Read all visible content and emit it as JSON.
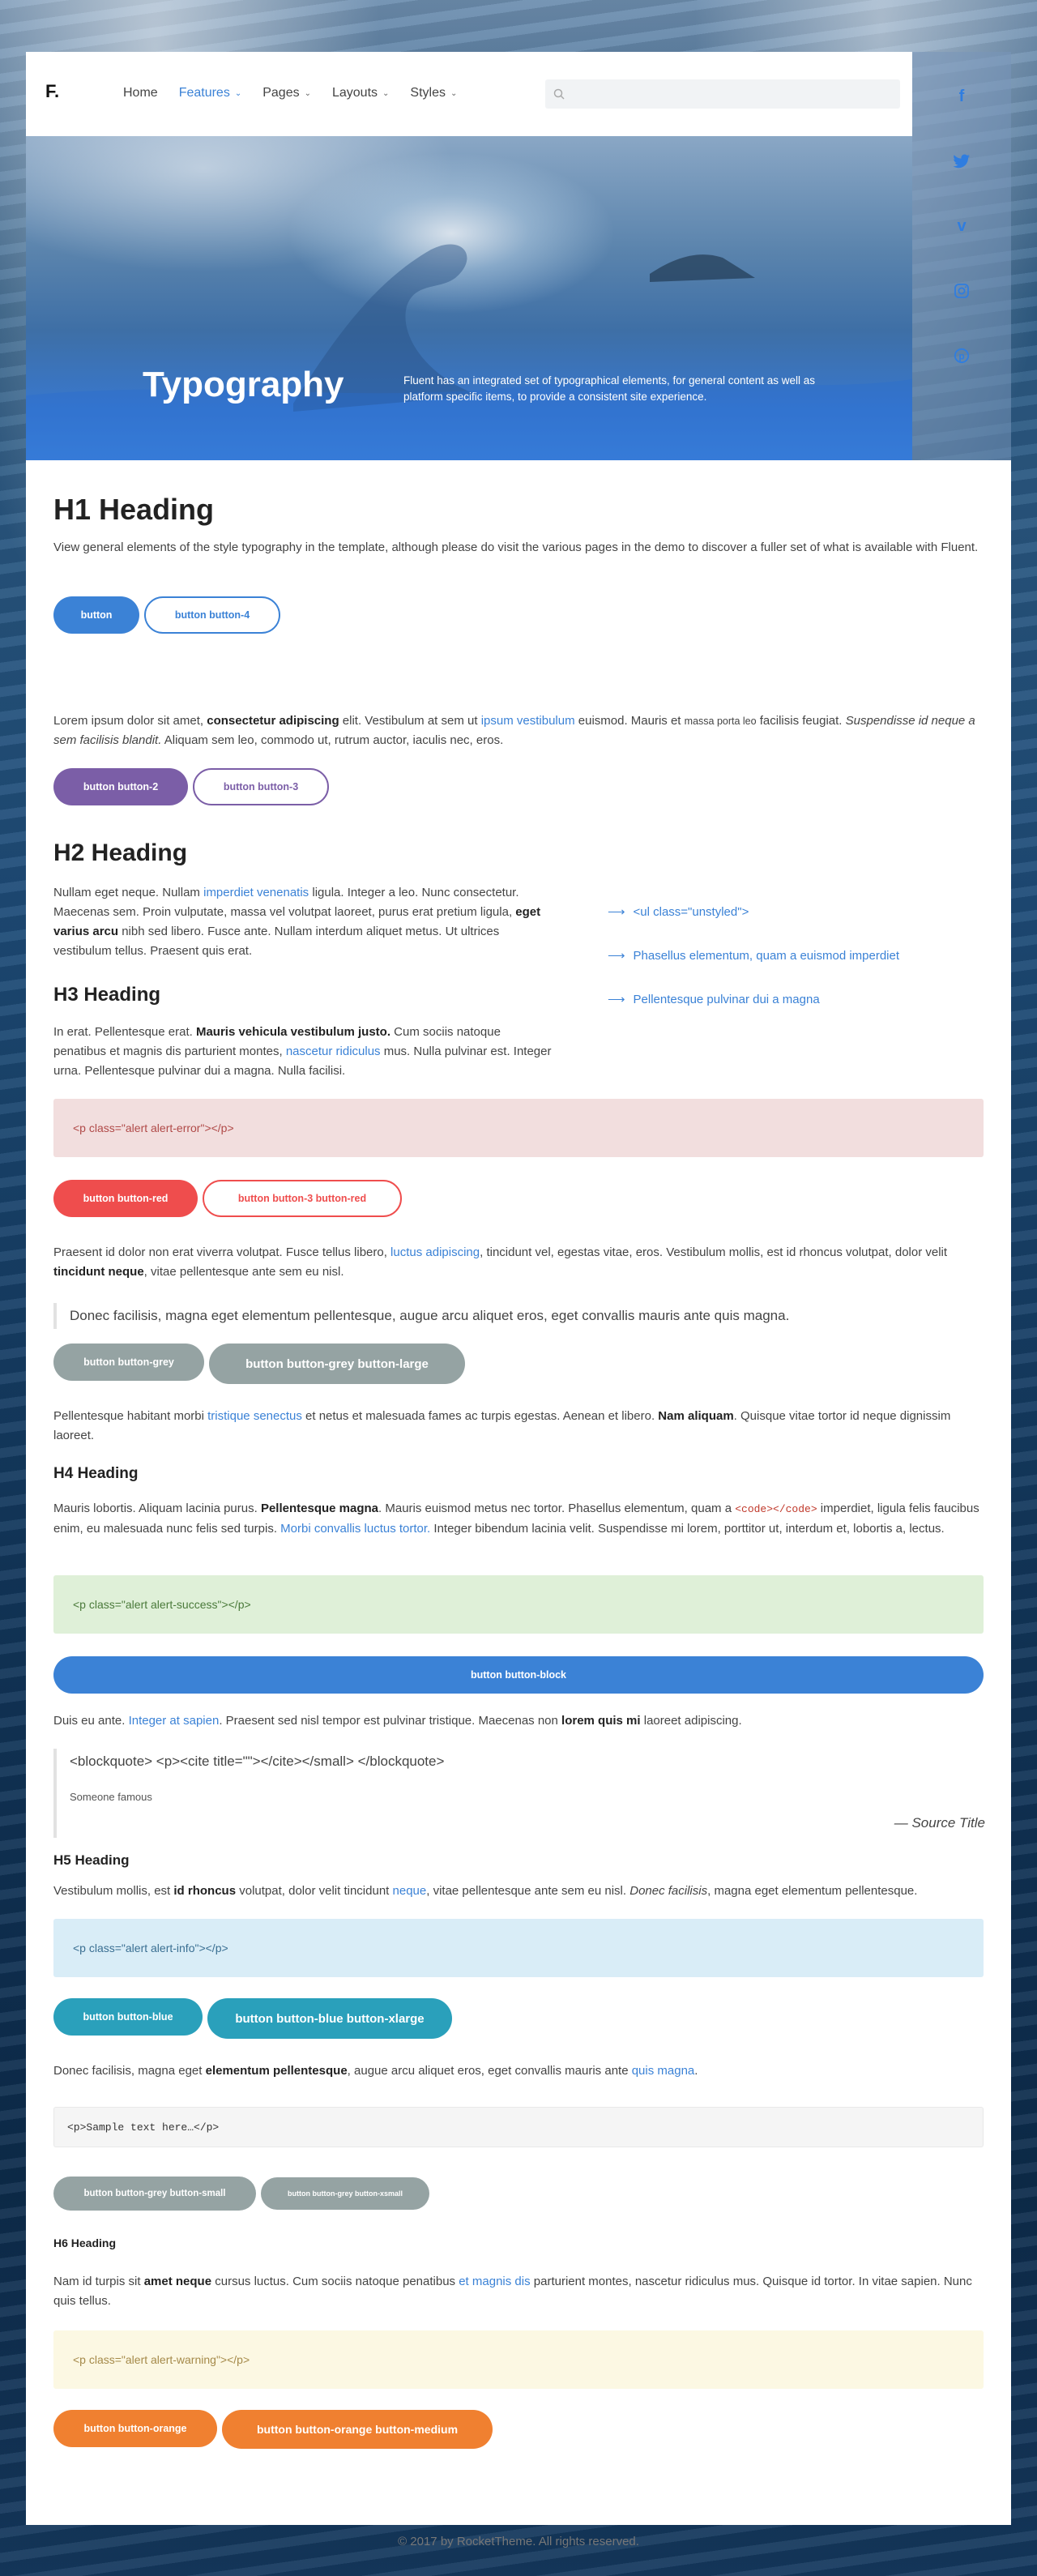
{
  "header": {
    "logo": "F.",
    "nav": [
      {
        "label": "Home",
        "active": false,
        "has_dropdown": false
      },
      {
        "label": "Features",
        "active": true,
        "has_dropdown": true
      },
      {
        "label": "Pages",
        "active": false,
        "has_dropdown": true
      },
      {
        "label": "Layouts",
        "active": false,
        "has_dropdown": true
      },
      {
        "label": "Styles",
        "active": false,
        "has_dropdown": true
      }
    ],
    "search_placeholder": ""
  },
  "social": [
    "facebook-icon",
    "twitter-icon",
    "vimeo-icon",
    "instagram-icon",
    "pinterest-icon"
  ],
  "hero": {
    "title": "Typography",
    "description": "Fluent has an integrated set of typographical elements, for general content as well as platform specific items, to provide a consistent site experience."
  },
  "content": {
    "h1": "H1 Heading",
    "intro": "View general elements of the style typography in the template, although please do visit the various pages in the demo to discover a fuller set of what is available with Fluent.",
    "btn_button": "button",
    "btn_button4": "button button-4",
    "para1": {
      "a": "Lorem ipsum dolor sit amet, ",
      "b": "consectetur adipiscing",
      "c": " elit. Vestibulum at sem ut ",
      "link": "ipsum vestibulum",
      "d": " euismod. Mauris et ",
      "small": "massa porta leo",
      "e": " facilisis feugiat. ",
      "em": "Suspendisse id neque a sem facilisis blandit.",
      "f": " Aliquam sem leo, commodo ut, rutrum auctor, iaculis nec, eros."
    },
    "btn_button2": "button button-2",
    "btn_button3": "button button-3",
    "h2": "H2 Heading",
    "para2": {
      "a": "Nullam eget neque. Nullam ",
      "link": "imperdiet venenatis",
      "b": " ligula. Integer a leo. Nunc consectetur. Maecenas sem. Proin vulputate, massa vel volutpat laoreet, purus erat pretium ligula, ",
      "bold": "eget varius arcu",
      "c": " nibh sed libero. Fusce ante. Nullam interdum aliquet metus. Ut ultrices vestibulum tellus. Praesent quis erat."
    },
    "list": [
      "<ul class=\"unstyled\">",
      "Phasellus elementum, quam a euismod imperdiet",
      "Pellentesque pulvinar dui a magna"
    ],
    "h3": "H3 Heading",
    "para3": {
      "a": "In erat. Pellentesque erat. ",
      "bold": "Mauris vehicula vestibulum justo.",
      "b": " Cum sociis natoque penatibus et magnis dis parturient montes, ",
      "link": "nascetur ridiculus",
      "c": " mus. Nulla pulvinar est. Integer urna. Pellentesque pulvinar dui a magna. Nulla facilisi."
    },
    "alert_error": "<p class=\"alert alert-error\"></p>",
    "btn_red": "button button-red",
    "btn_red3": "button button-3 button-red",
    "para4": {
      "a": "Praesent id dolor non erat viverra volutpat. Fusce tellus libero, ",
      "link": "luctus adipiscing",
      "b": ", tincidunt vel, egestas vitae, eros. Vestibulum mollis, est id rhoncus volutpat, dolor velit ",
      "bold": "tincidunt neque",
      "c": ", vitae pellentesque ante sem eu nisl."
    },
    "quote1": "Donec facilisis, magna eget elementum pellentesque, augue arcu aliquet eros, eget convallis mauris ante quis magna.",
    "btn_grey": "button button-grey",
    "btn_grey_large": "button button-grey button-large",
    "para5": {
      "a": "Pellentesque habitant morbi ",
      "link": "tristique senectus",
      "b": " et netus et malesuada fames ac turpis egestas. Aenean et libero. ",
      "bold": "Nam aliquam",
      "c": ". Quisque vitae tortor id neque dignissim laoreet."
    },
    "h4": "H4 Heading",
    "para6": {
      "a": "Mauris lobortis. Aliquam lacinia purus. ",
      "bold": "Pellentesque magna",
      "b": ". Mauris euismod metus nec tortor. Phasellus elementum, quam a ",
      "code": "<code></code>",
      "c": " imperdiet, ligula felis faucibus enim, eu malesuada nunc felis sed turpis. ",
      "link": "Morbi convallis luctus tortor.",
      "d": " Integer bibendum lacinia velit. Suspendisse mi lorem, porttitor ut, interdum et, lobortis a, lectus."
    },
    "alert_success": "<p class=\"alert alert-success\"></p>",
    "btn_block": "button button-block",
    "para7": {
      "a": "Duis eu ante. ",
      "link": "Integer at sapien",
      "b": ". Praesent sed nisl tempor est pulvinar tristique. Maecenas non ",
      "bold": "lorem quis mi",
      "c": " laoreet adipiscing."
    },
    "blockquote": {
      "text": "<blockquote> <p><cite title=\"\"></cite></small> </blockquote>",
      "author": "Someone famous",
      "source": "— Source Title"
    },
    "h5": "H5 Heading",
    "para8": {
      "a": "Vestibulum mollis, est ",
      "bold": "id rhoncus",
      "b": " volutpat, dolor velit tincidunt ",
      "link": "neque",
      "c": ", vitae pellentesque ante sem eu nisl. ",
      "em": "Donec facilisis",
      "d": ", magna eget elementum pellentesque."
    },
    "alert_info": "<p class=\"alert alert-info\"></p>",
    "btn_blue": "button button-blue",
    "btn_blue_xlarge": "button button-blue button-xlarge",
    "para9": {
      "a": "Donec facilisis, magna eget ",
      "bold": "elementum pellentesque",
      "b": ", augue arcu aliquet eros, eget convallis mauris ante ",
      "link": "quis magna",
      "c": "."
    },
    "pre": "<p>Sample text here…</p>",
    "btn_grey_small": "button button-grey button-small",
    "btn_grey_xsmall": "button button-grey button-xsmall",
    "h6": "H6 Heading",
    "para10": {
      "a": "Nam id turpis sit ",
      "bold": "amet neque",
      "b": " cursus luctus. Cum sociis natoque penatibus ",
      "link": "et magnis dis",
      "c": " parturient montes, nascetur ridiculus mus. Quisque id tortor. In vitae sapien. Nunc quis tellus."
    },
    "alert_warning": "<p class=\"alert alert-warning\"></p>",
    "btn_orange": "button button-orange",
    "btn_orange_medium": "button button-orange button-medium"
  },
  "footer": "© 2017 by RocketTheme. All rights reserved.",
  "colors": {
    "blue": "#3b82d6",
    "purple": "#7b5ea7",
    "red": "#ef4d4d",
    "grey": "#95a3a3",
    "teal": "#2aa0bb",
    "orange": "#f08030"
  }
}
